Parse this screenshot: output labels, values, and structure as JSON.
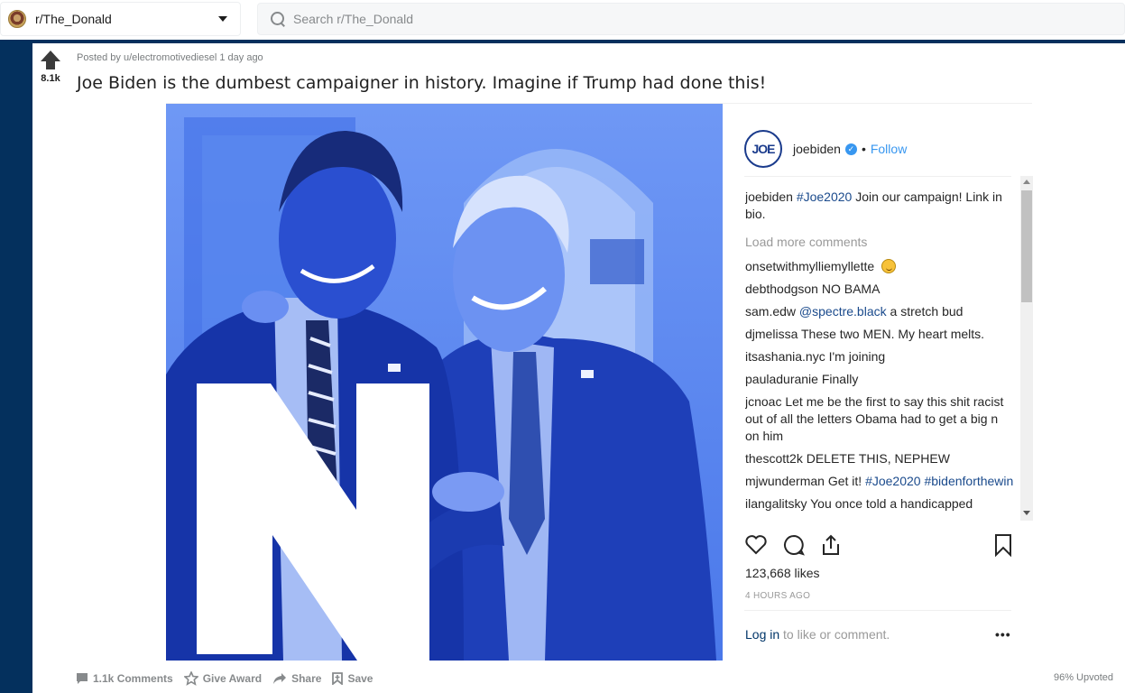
{
  "header": {
    "subreddit": "r/The_Donald",
    "search_placeholder": "Search r/The_Donald"
  },
  "post": {
    "score": "8.1k",
    "meta": "Posted by u/electromotivediesel 1 day ago",
    "title": "Joe Biden is the dumbest campaigner in history. Imagine if Trump had done this!",
    "upvoted": "96% Upvoted",
    "actions": {
      "comments": "1.1k Comments",
      "award": "Give Award",
      "share": "Share",
      "save": "Save"
    }
  },
  "instagram": {
    "avatar_text": "JOE",
    "username": "joebiden",
    "separator": "•",
    "follow": "Follow",
    "caption_user": "joebiden",
    "caption_tag": "#Joe2020",
    "caption_text": "Join our campaign! Link in bio.",
    "load_more": "Load more comments",
    "comments": [
      {
        "user": "onsetwithmylliemyllette",
        "text": ""
      },
      {
        "user": "debthodgson",
        "text": "NO BAMA"
      },
      {
        "user": "sam.edw",
        "tag": "@spectre.black",
        "text": "a stretch bud"
      },
      {
        "user": "djmelissa",
        "text": "These two MEN. My heart melts."
      },
      {
        "user": "itsashania.nyc",
        "text": "I'm joining"
      },
      {
        "user": "pauladuranie",
        "text": "Finally"
      },
      {
        "user": "jcnoac",
        "text": "Let me be the first to say this shit racist out of all the letters Obama had to get a big n on him"
      },
      {
        "user": "thescott2k",
        "text": "DELETE THIS, NEPHEW"
      },
      {
        "user": "mjwunderman",
        "text": "Get it!",
        "tag": "#Joe2020 #bidenforthewin"
      },
      {
        "user": "ilangalitsky",
        "text": "You once told a handicapped"
      }
    ],
    "likes": "123,668 likes",
    "time": "4 HOURS AGO",
    "login_link": "Log in",
    "login_text": " to like or comment.",
    "more": "•••"
  },
  "colors": {
    "reddit_blue": "#04305d",
    "ig_link": "#3897f0",
    "photo_tint": "#2d5fe0"
  }
}
